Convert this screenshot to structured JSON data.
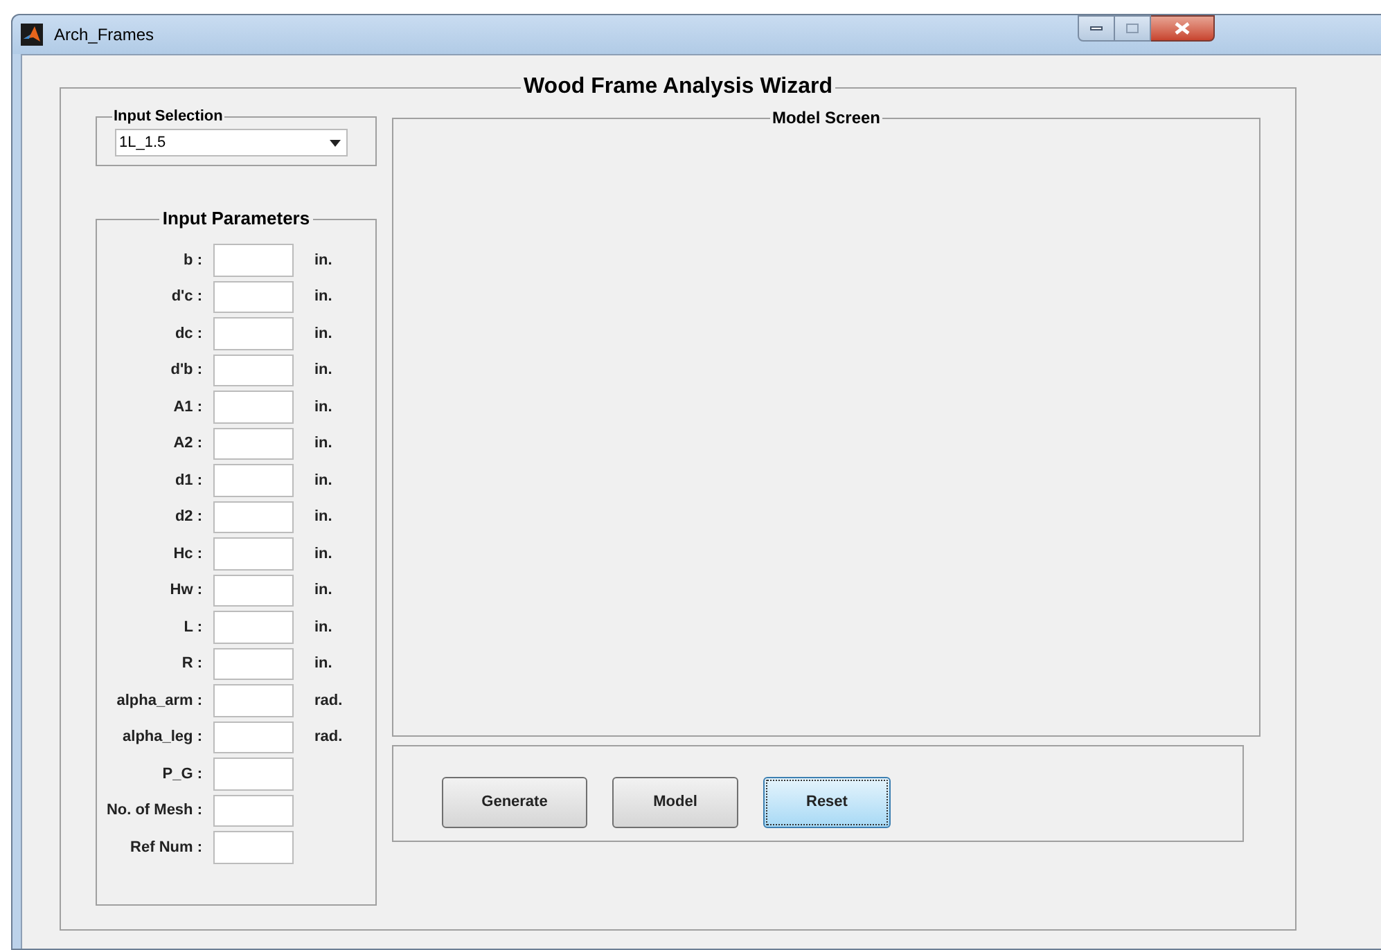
{
  "window": {
    "title": "Arch_Frames"
  },
  "wizard": {
    "title": "Wood Frame Analysis Wizard"
  },
  "input_selection": {
    "title": "Input Selection",
    "value": "1L_1.5"
  },
  "input_parameters": {
    "title": "Input Parameters",
    "fields": [
      {
        "label": "b :",
        "unit": "in."
      },
      {
        "label": "d'c :",
        "unit": "in."
      },
      {
        "label": "dc :",
        "unit": "in."
      },
      {
        "label": "d'b :",
        "unit": "in."
      },
      {
        "label": "A1 :",
        "unit": "in."
      },
      {
        "label": "A2 :",
        "unit": "in."
      },
      {
        "label": "d1 :",
        "unit": "in."
      },
      {
        "label": "d2 :",
        "unit": "in."
      },
      {
        "label": "Hc :",
        "unit": "in."
      },
      {
        "label": "Hw :",
        "unit": "in."
      },
      {
        "label": "L :",
        "unit": "in."
      },
      {
        "label": "R :",
        "unit": "in."
      },
      {
        "label": "alpha_arm :",
        "unit": "rad."
      },
      {
        "label": "alpha_leg :",
        "unit": "rad."
      },
      {
        "label": "P_G :"
      },
      {
        "label": "No. of Mesh :"
      },
      {
        "label": "Ref Num :"
      }
    ]
  },
  "model_screen": {
    "title": "Model Screen"
  },
  "buttons": [
    {
      "label": "Generate",
      "focused": false
    },
    {
      "label": "Model",
      "focused": false
    },
    {
      "label": "Reset",
      "focused": true
    }
  ]
}
